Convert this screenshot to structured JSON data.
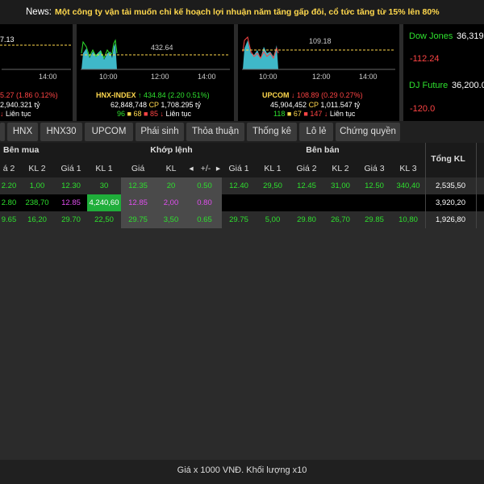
{
  "news": {
    "label": "News:",
    "headline": "Một công ty vận tải muốn chỉ kế hoạch lợi nhuận năm tăng gấp đôi, cổ tức tăng từ 15% lên 80%"
  },
  "indices": [
    {
      "chart_label": "7.13",
      "time_labels": [
        "",
        "14:00"
      ],
      "name": "",
      "change": "5.27",
      "pct": "(1.86  0.12%)",
      "vol": "2,940.321 tỷ",
      "status": "Liên tục"
    },
    {
      "chart_label": "432.64",
      "time_labels": [
        "10:00",
        "12:00",
        "14:00"
      ],
      "name": "HNX-INDEX",
      "value": "434.84",
      "pct": "(2.20  0.51%)",
      "volume": "62,848,748",
      "cp": "CP",
      "value_bn": "1,708.295 tỷ",
      "up": "96",
      "ref": "68",
      "down": "85",
      "status": "Liên tục"
    },
    {
      "chart_label": "109.18",
      "time_labels": [
        "10:00",
        "12:00",
        "14:00"
      ],
      "name": "UPCOM",
      "value": "108.89",
      "pct": "(0.29  0.27%)",
      "volume": "45,904,452",
      "cp": "CP",
      "value_bn": "1,011.547 tỷ",
      "up": "118",
      "ref": "67",
      "down": "147",
      "status": "Liên tục"
    }
  ],
  "world": {
    "dow_label": "Dow Jones",
    "dow_value": "36,319",
    "dow_change": "-112.24",
    "dj_label": "DJ Future",
    "dj_value": "36,200.0",
    "dj_change": "-120.0"
  },
  "tabs": [
    "HNX",
    "HNX30",
    "UPCOM",
    "Phái sinh",
    "Thỏa thuận",
    "Thống kê",
    "Lô lẻ",
    "Chứng quyền"
  ],
  "table": {
    "group_buy": "Bên mua",
    "group_match": "Khớp lệnh",
    "group_sell": "Bên bán",
    "total": "Tổng KL",
    "cols": [
      "á 2",
      "KL 2",
      "Giá 1",
      "KL 1",
      "Giá",
      "KL",
      "+/-",
      "Giá 1",
      "KL 1",
      "Giá 2",
      "KL 2",
      "Giá 3",
      "KL 3"
    ],
    "rows": [
      [
        "2.20",
        "1,00",
        "12.30",
        "30",
        "12.35",
        "20",
        "0.50",
        "12.40",
        "29,50",
        "12.45",
        "31,00",
        "12.50",
        "340,40",
        "2,535,50"
      ],
      [
        "2.80",
        "238,70",
        "12.85",
        "4,240,60",
        "12.85",
        "2,00",
        "0.80",
        "",
        "",
        "",
        "",
        "",
        "",
        "3,920,20"
      ],
      [
        "9.65",
        "16,20",
        "29.70",
        "22,50",
        "29.75",
        "3,50",
        "0.65",
        "29.75",
        "5,00",
        "29.80",
        "26,70",
        "29.85",
        "10,80",
        "1,926,80"
      ]
    ]
  },
  "footer": "Giá x 1000 VNĐ. Khối lượng x10",
  "colors": {
    "up": "#2ee02e",
    "down": "#ff4444",
    "ref": "#ffd84d",
    "ceil": "#e14ef0",
    "chart_fill": "#3fb8c8"
  }
}
